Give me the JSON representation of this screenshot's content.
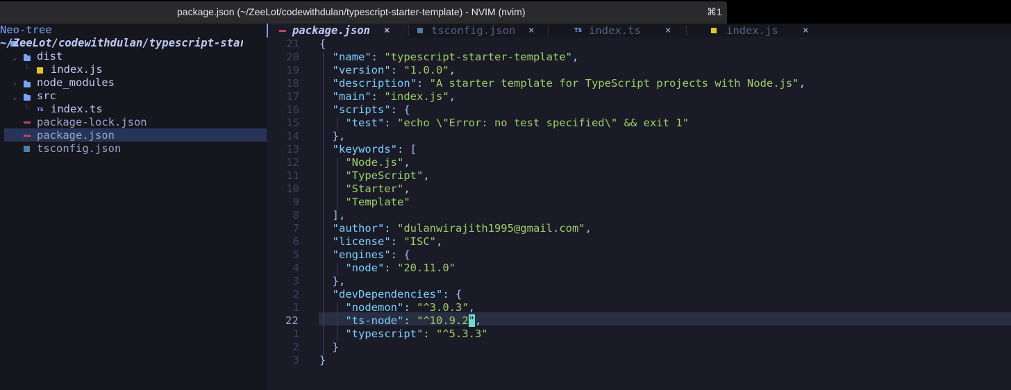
{
  "window": {
    "title": "package.json (~/ZeeLot/codewithdulan/typescript-starter-template) - NVIM (nvim)",
    "shortcut": "⌘1"
  },
  "sidebar": {
    "header": "Neo-tree",
    "root": "~/ZeeLot/codewithdulan/typescript-starter-template",
    "items": [
      {
        "label": "dist",
        "type": "folder",
        "expanded": true
      },
      {
        "label": "index.js",
        "type": "js"
      },
      {
        "label": "node_modules",
        "type": "folder",
        "expanded": false
      },
      {
        "label": "src",
        "type": "folder",
        "expanded": true
      },
      {
        "label": "index.ts",
        "type": "ts"
      },
      {
        "label": "package-lock.json",
        "type": "json"
      },
      {
        "label": "package.json",
        "type": "json",
        "selected": true
      },
      {
        "label": "tsconfig.json",
        "type": "tsconfig"
      }
    ]
  },
  "tabs": [
    {
      "label": "package.json",
      "icon": "json-icon",
      "active": true,
      "close": "×"
    },
    {
      "label": "tsconfig.json",
      "icon": "tsconfig-icon",
      "active": false,
      "close": "×"
    },
    {
      "label": "index.ts",
      "icon": "ts-icon",
      "active": false,
      "close": "×"
    },
    {
      "label": "index.js",
      "icon": "js-icon",
      "active": false,
      "close": "×"
    }
  ],
  "editor": {
    "line_numbers": [
      "21",
      "20",
      "19",
      "18",
      "17",
      "16",
      "15",
      "14",
      "13",
      "12",
      "11",
      "10",
      "9",
      "8",
      "7",
      "6",
      "5",
      "4",
      "3",
      "2",
      "1",
      "22",
      "1",
      "2",
      "3"
    ],
    "cursor_line_index": 21,
    "cursor_char": "\""
  },
  "code": {
    "name_key": "\"name\"",
    "name_val": "\"typescript-starter-template\"",
    "version_key": "\"version\"",
    "version_val": "\"1.0.0\"",
    "description_key": "\"description\"",
    "description_val": "\"A starter template for TypeScript projects with Node.js\"",
    "main_key": "\"main\"",
    "main_val": "\"index.js\"",
    "scripts_key": "\"scripts\"",
    "test_key": "\"test\"",
    "test_val": "\"echo \\\"Error: no test specified\\\" && exit 1\"",
    "keywords_key": "\"keywords\"",
    "kw1": "\"Node.js\"",
    "kw2": "\"TypeScript\"",
    "kw3": "\"Starter\"",
    "kw4": "\"Template\"",
    "author_key": "\"author\"",
    "author_val": "\"dulanwirajith1995@gmail.com\"",
    "license_key": "\"license\"",
    "license_val": "\"ISC\"",
    "engines_key": "\"engines\"",
    "node_key": "\"node\"",
    "node_val": "\"20.11.0\"",
    "devdeps_key": "\"devDependencies\"",
    "nodemon_key": "\"nodemon\"",
    "nodemon_val": "\"^3.0.3\"",
    "tsnode_key": "\"ts-node\"",
    "tsnode_val": "\"^10.9.2",
    "typescript_key": "\"typescript\"",
    "typescript_val": "\"^5.3.3\""
  },
  "colors": {
    "background": "#1a1b26",
    "sidebar": "#16161e",
    "key": "#7dcfff",
    "string": "#9ece6a",
    "accent": "#7aa2f7"
  }
}
